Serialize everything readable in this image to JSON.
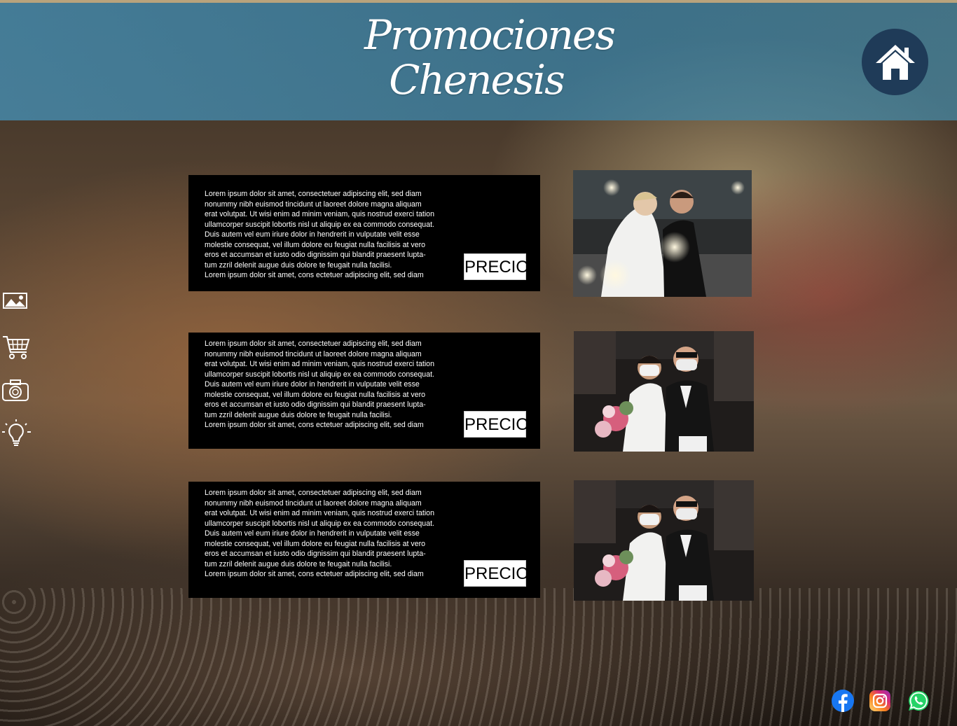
{
  "header": {
    "title_line1": "Promociones",
    "title_line2": "Chenesis",
    "home_icon": "home-icon"
  },
  "sidebar": {
    "icons": [
      "gallery-icon",
      "cart-icon",
      "camera-icon",
      "lightbulb-icon"
    ]
  },
  "promotions": [
    {
      "lines": [
        "Lorem ipsum dolor sit amet, consectetuer adipiscing elit, sed diam",
        "nonummy nibh euismod tincidunt ut laoreet dolore magna aliquam",
        "erat volutpat. Ut wisi enim ad minim veniam, quis nostrud exerci tation",
        "ullamcorper suscipit lobortis nisl ut aliquip ex ea commodo consequat.",
        "Duis autem vel eum iriure dolor in hendrerit in vulputate velit esse",
        "molestie consequat, vel illum dolore eu feugiat nulla facilisis at vero",
        "eros et accumsan et iusto odio dignissim qui blandit praesent lupta-",
        "tum zzril delenit augue duis dolore te feugait nulla facilisi.",
        "Lorem ipsum dolor sit amet, cons ectetuer adipiscing elit, sed diam"
      ],
      "price_label": "PRECIO",
      "photo": "couple-with-sparklers-photo"
    },
    {
      "lines": [
        "Lorem ipsum dolor sit amet, consectetuer adipiscing elit, sed diam",
        "nonummy nibh euismod tincidunt ut laoreet dolore magna aliquam",
        "erat volutpat. Ut wisi enim ad minim veniam, quis nostrud exerci tation",
        "ullamcorper suscipit lobortis nisl ut aliquip ex ea commodo consequat.",
        "Duis autem vel eum iriure dolor in hendrerit in vulputate velit esse",
        "molestie consequat, vel illum dolore eu feugiat nulla facilisis at vero",
        "eros et accumsan et iusto odio dignissim qui blandit praesent lupta-",
        "tum zzril delenit augue duis dolore te feugait nulla facilisi.",
        "Lorem ipsum dolor sit amet, cons ectetuer adipiscing elit, sed diam"
      ],
      "price_label": "PRECIO",
      "photo": "masked-bride-and-father-photo"
    },
    {
      "lines": [
        "Lorem ipsum dolor sit amet, consectetuer adipiscing elit, sed diam",
        "nonummy nibh euismod tincidunt ut laoreet dolore magna aliquam",
        "erat volutpat. Ut wisi enim ad minim veniam, quis nostrud exerci tation",
        "ullamcorper suscipit lobortis nisl ut aliquip ex ea commodo consequat.",
        "Duis autem vel eum iriure dolor in hendrerit in vulputate velit esse",
        "molestie consequat, vel illum dolore eu feugiat nulla facilisis at vero",
        "eros et accumsan et iusto odio dignissim qui blandit praesent lupta-",
        "tum zzril delenit augue duis dolore te feugait nulla facilisi.",
        "Lorem ipsum dolor sit amet, cons ectetuer adipiscing elit, sed diam"
      ],
      "price_label": "PRECIO",
      "photo": "masked-bride-and-father-photo"
    }
  ],
  "social": {
    "icons": [
      "facebook-icon",
      "instagram-icon",
      "whatsapp-icon"
    ],
    "colors": {
      "facebook": "#1877f2",
      "whatsapp": "#25d366",
      "instagram_start": "#feda75",
      "instagram_end": "#962fbf"
    }
  },
  "colors": {
    "header_band": "#468cb0",
    "home_button": "#1f3b58",
    "card_background": "#000000"
  }
}
